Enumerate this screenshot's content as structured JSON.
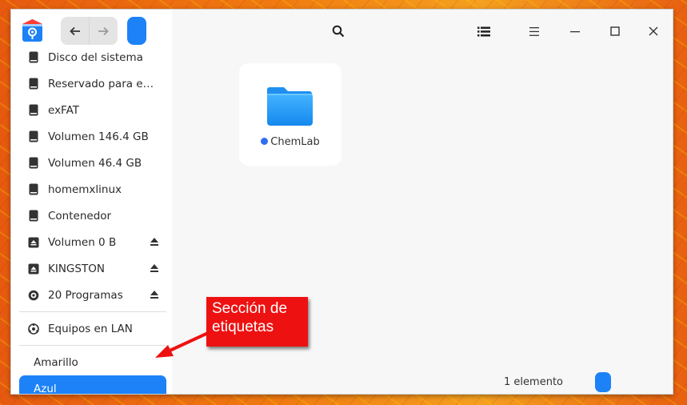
{
  "titlebar": {
    "app_icon": "file-manager-icon",
    "back_icon": "arrow-left-icon",
    "forward_icon": "arrow-right-icon",
    "search_icon": "search-icon",
    "list_view_icon": "list-view-icon",
    "menu_icon": "hamburger-menu-icon",
    "minimize_icon": "minimize-icon",
    "maximize_icon": "maximize-icon",
    "close_icon": "close-icon"
  },
  "sidebar": {
    "devices": [
      {
        "label": "Disco del sistema",
        "icon": "drive-icon",
        "eject": false
      },
      {
        "label": "Reservado para el sistema",
        "icon": "drive-icon",
        "eject": false
      },
      {
        "label": "exFAT",
        "icon": "drive-icon",
        "eject": false
      },
      {
        "label": "Volumen 146.4 GB",
        "icon": "drive-icon",
        "eject": false
      },
      {
        "label": "Volumen 46.4 GB",
        "icon": "drive-icon",
        "eject": false
      },
      {
        "label": "homemxlinux",
        "icon": "drive-icon",
        "eject": false
      },
      {
        "label": "Contenedor",
        "icon": "drive-icon",
        "eject": false
      },
      {
        "label": "Volumen 0 B",
        "icon": "removable-drive-icon",
        "eject": true
      },
      {
        "label": "KINGSTON",
        "icon": "removable-drive-icon",
        "eject": true
      },
      {
        "label": "20 Programas",
        "icon": "optical-disc-icon",
        "eject": true
      }
    ],
    "network": {
      "label": "Equipos en LAN",
      "icon": "network-icon"
    },
    "tags": [
      {
        "label": "Amarillo",
        "active": false
      },
      {
        "label": "Azul",
        "active": true
      }
    ]
  },
  "main": {
    "items": [
      {
        "name": "ChemLab",
        "icon": "folder-icon",
        "tag_color": "#2f6df5"
      }
    ],
    "status": "1 elemento"
  },
  "annotation": {
    "text": "Sección de etiquetas",
    "color": "#ee1111"
  },
  "colors": {
    "accent": "#1d82f7"
  }
}
